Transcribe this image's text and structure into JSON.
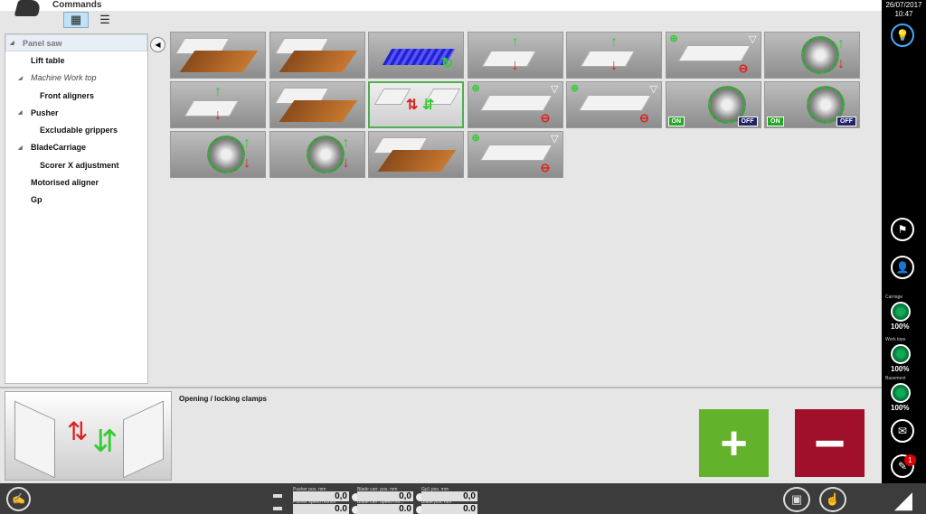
{
  "header": {
    "title": "Commands",
    "view_grid_icon": "grid-view-icon",
    "view_list_icon": "list-view-icon"
  },
  "tree": [
    {
      "label": "Panel saw",
      "level": 0,
      "expanded": true,
      "selected": true
    },
    {
      "label": "Lift table",
      "level": 1
    },
    {
      "label": "Machine Work top",
      "level": 1,
      "expanded": true,
      "italic": true
    },
    {
      "label": "Front aligners",
      "level": 2
    },
    {
      "label": "Pusher",
      "level": 1,
      "expanded": true
    },
    {
      "label": "Excludable grippers",
      "level": 2
    },
    {
      "label": "BladeCarriage",
      "level": 1,
      "expanded": true
    },
    {
      "label": "Scorer X adjustment",
      "level": 2
    },
    {
      "label": "Motorised aligner",
      "level": 1
    },
    {
      "label": "Gp",
      "level": 1
    }
  ],
  "tiles": [
    {
      "kind": "wood"
    },
    {
      "kind": "wood"
    },
    {
      "kind": "rail"
    },
    {
      "kind": "arrows"
    },
    {
      "kind": "arrows"
    },
    {
      "kind": "plusminus"
    },
    {
      "kind": "saw"
    },
    {
      "kind": "arrows"
    },
    {
      "kind": "wood"
    },
    {
      "kind": "clamps",
      "selected": true
    },
    {
      "kind": "plusminus"
    },
    {
      "kind": "plusminus"
    },
    {
      "kind": "onoff",
      "on": "ON",
      "off": "OFF"
    },
    {
      "kind": "onoff",
      "on": "ON",
      "off": "OFF"
    },
    {
      "kind": "saw"
    },
    {
      "kind": "saw"
    },
    {
      "kind": "wood"
    },
    {
      "kind": "plusminus"
    }
  ],
  "detail": {
    "label": "Opening / locking clamps",
    "plus": "+",
    "minus": "−"
  },
  "sidebar": {
    "date": "26/07/2017",
    "time": "10:47",
    "gauges": [
      {
        "label": "Carriage",
        "value": "100%"
      },
      {
        "label": "Work tops",
        "value": "100%"
      },
      {
        "label": "Basement",
        "value": "100%"
      }
    ],
    "notification_count": "1"
  },
  "readouts": [
    {
      "label": "Pusher pos.     mm",
      "value": "0,0"
    },
    {
      "label": "Pusher speed  mt/min",
      "value": "0.0"
    },
    {
      "label": "Blade carr. pos.   mm",
      "value": "0,0"
    },
    {
      "label": "Blade carr. speed  mt/...",
      "value": "0.0"
    },
    {
      "label": "Gp1 pos.        mm",
      "value": "0,0"
    },
    {
      "label": "Blade pos.      mm",
      "value": "0.0"
    }
  ],
  "colors": {
    "plus": "#63b22c",
    "minus": "#a0102a",
    "selected_tile": "#4caf50"
  }
}
